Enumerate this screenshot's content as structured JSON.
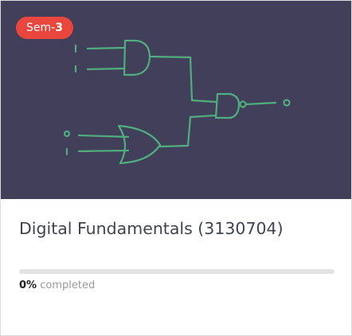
{
  "course": {
    "badge_prefix": "Sem-",
    "badge_number": "3",
    "title": "Digital Fundamentals (3130704)",
    "progress_percent": "0%",
    "progress_fraction": 0,
    "progress_label": "completed"
  },
  "thumbnail": {
    "background_color": "#423f5b",
    "line_color": "#4fae7d",
    "badge_color": "#e9473d",
    "illustration": "logic-gate-circuit"
  }
}
